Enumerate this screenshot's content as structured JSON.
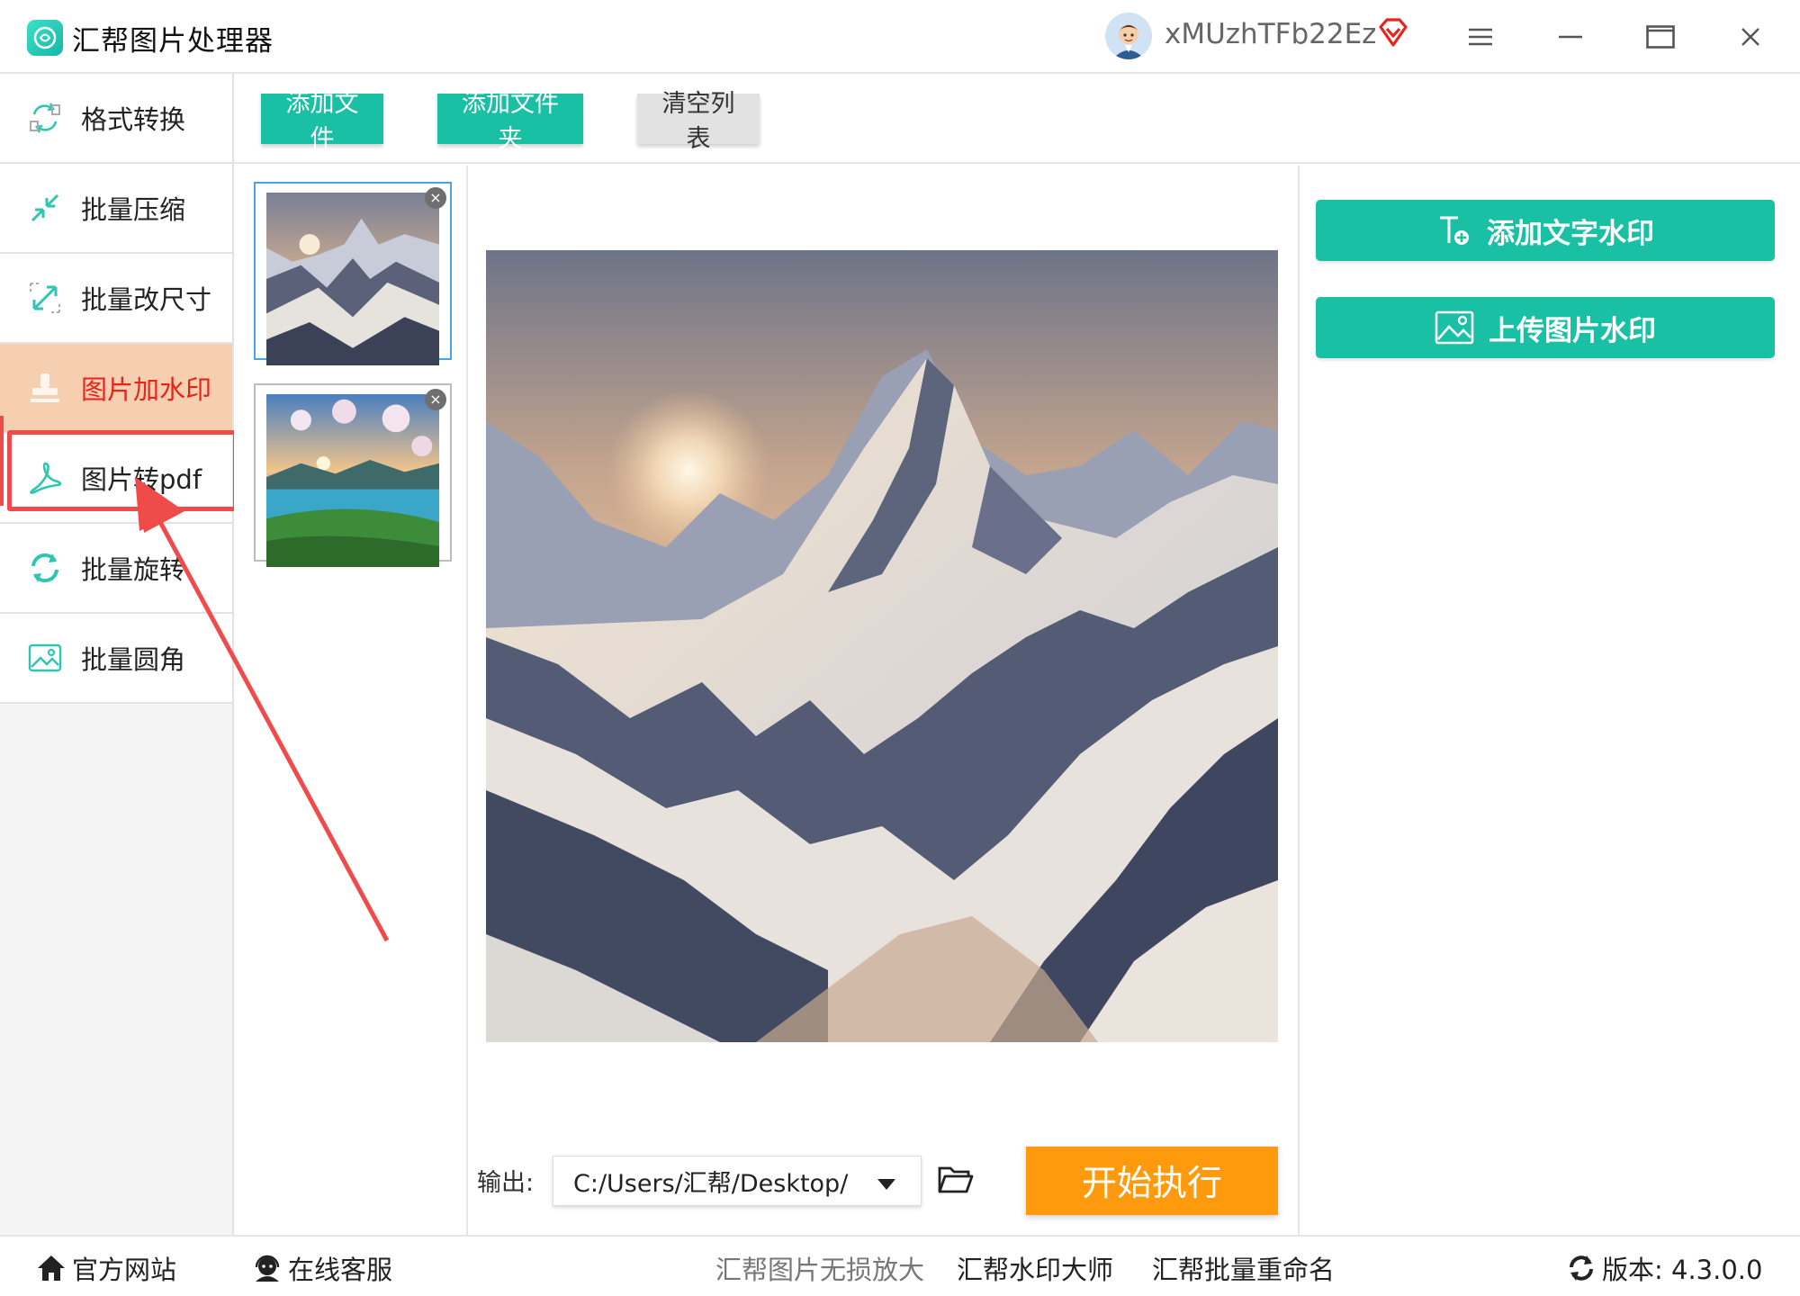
{
  "window": {
    "title": "汇帮图片处理器",
    "username": "xMUzhTFb22Ez"
  },
  "sidebar": {
    "items": [
      {
        "label": "格式转换",
        "icon": "format-convert-icon"
      },
      {
        "label": "批量压缩",
        "icon": "compress-icon"
      },
      {
        "label": "批量改尺寸",
        "icon": "resize-icon"
      },
      {
        "label": "图片加水印",
        "icon": "stamp-icon",
        "active": true
      },
      {
        "label": "图片转pdf",
        "icon": "pdf-icon"
      },
      {
        "label": "批量旋转",
        "icon": "rotate-icon"
      },
      {
        "label": "批量圆角",
        "icon": "round-corner-icon"
      }
    ]
  },
  "toolbar": {
    "add_file": "添加文件",
    "add_folder": "添加文件夹",
    "clear_list": "清空列表"
  },
  "thumbnails": [
    {
      "name": "snowy-mountain",
      "selected": true
    },
    {
      "name": "lake-landscape",
      "selected": false
    }
  ],
  "output": {
    "label": "输出:",
    "path": "C:/Users/汇帮/Desktop/",
    "start_label": "开始执行"
  },
  "watermark": {
    "add_text": "添加文字水印",
    "upload_image": "上传图片水印"
  },
  "statusbar": {
    "official_site": "官方网站",
    "online_service": "在线客服",
    "link1": "汇帮图片无损放大",
    "link2": "汇帮水印大师",
    "link3": "汇帮批量重命名",
    "version": "版本: 4.3.0.0"
  },
  "colors": {
    "accent": "#19c0a4",
    "start": "#ff9a0e",
    "active_bg": "#f6cfb0",
    "active_text": "#e8231a",
    "annotation": "#f04b4b"
  }
}
